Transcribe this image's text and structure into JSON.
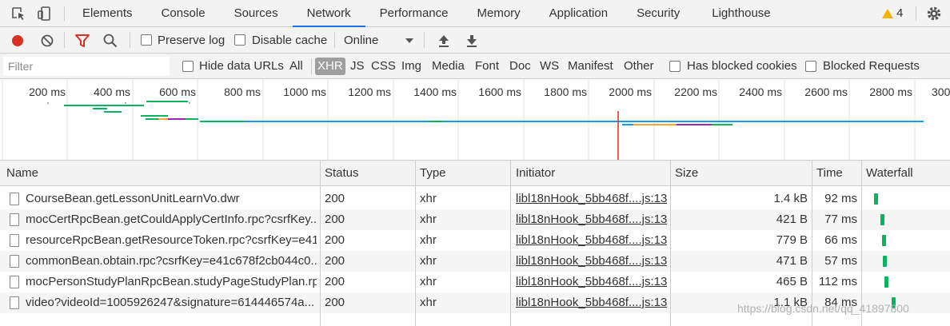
{
  "tabs": [
    "Elements",
    "Console",
    "Sources",
    "Network",
    "Performance",
    "Memory",
    "Application",
    "Security",
    "Lighthouse"
  ],
  "active_tab": "Network",
  "warnings_count": "4",
  "toolbar": {
    "preserve_log": "Preserve log",
    "disable_cache": "Disable cache",
    "throttling": "Online"
  },
  "filter": {
    "placeholder": "Filter",
    "hide_data_urls": "Hide data URLs",
    "types": [
      "All",
      "XHR",
      "JS",
      "CSS",
      "Img",
      "Media",
      "Font",
      "Doc",
      "WS",
      "Manifest",
      "Other"
    ],
    "active_type": "XHR",
    "has_blocked_cookies": "Has blocked cookies",
    "blocked_requests": "Blocked Requests"
  },
  "overview": {
    "ticks": [
      "200 ms",
      "400 ms",
      "600 ms",
      "800 ms",
      "1000 ms",
      "1200 ms",
      "1400 ms",
      "1600 ms",
      "1800 ms",
      "2000 ms",
      "2200 ms",
      "2400 ms",
      "2600 ms",
      "2800 ms",
      "300"
    ]
  },
  "columns": [
    "Name",
    "Status",
    "Type",
    "Initiator",
    "Size",
    "Time",
    "Waterfall"
  ],
  "rows": [
    {
      "name": "CourseBean.getLessonUnitLearnVo.dwr",
      "status": "200",
      "type": "xhr",
      "initiator": "libl18nHook_5bb468f....js:13",
      "size": "1.4 kB",
      "time": "92 ms",
      "wf": 0.12
    },
    {
      "name": "mocCertRpcBean.getCouldApplyCertInfo.rpc?csrfKey...",
      "status": "200",
      "type": "xhr",
      "initiator": "libl18nHook_5bb468f....js:13",
      "size": "421 B",
      "time": "77 ms",
      "wf": 0.19
    },
    {
      "name": "resourceRpcBean.getResourceToken.rpc?csrfKey=e41...",
      "status": "200",
      "type": "xhr",
      "initiator": "libl18nHook_5bb468f....js:13",
      "size": "779 B",
      "time": "66 ms",
      "wf": 0.21
    },
    {
      "name": "commonBean.obtain.rpc?csrfKey=e41c678f2cb044c0...",
      "status": "200",
      "type": "xhr",
      "initiator": "libl18nHook_5bb468f....js:13",
      "size": "471 B",
      "time": "57 ms",
      "wf": 0.22
    },
    {
      "name": "mocPersonStudyPlanRpcBean.studyPageStudyPlan.rp...",
      "status": "200",
      "type": "xhr",
      "initiator": "libl18nHook_5bb468f....js:13",
      "size": "465 B",
      "time": "112 ms",
      "wf": 0.24
    },
    {
      "name": "video?videoId=1005926247&signature=614446574a...",
      "status": "200",
      "type": "xhr",
      "initiator": "libl18nHook_5bb468f....js:13",
      "size": "1.1 kB",
      "time": "84 ms",
      "wf": 0.32
    }
  ],
  "watermark": "https://blog.csdn.net/qq_41897800",
  "colors": {
    "accent": "#1a73e8",
    "record": "#d93025",
    "filter_icon": "#d93025",
    "warning": "#f4b400",
    "bar_green": "#0bb35e",
    "bar_blue": "#1a9be6",
    "bar_orange": "#f2a32a",
    "bar_purple": "#9c27b0",
    "marker_red": "#d93025"
  }
}
